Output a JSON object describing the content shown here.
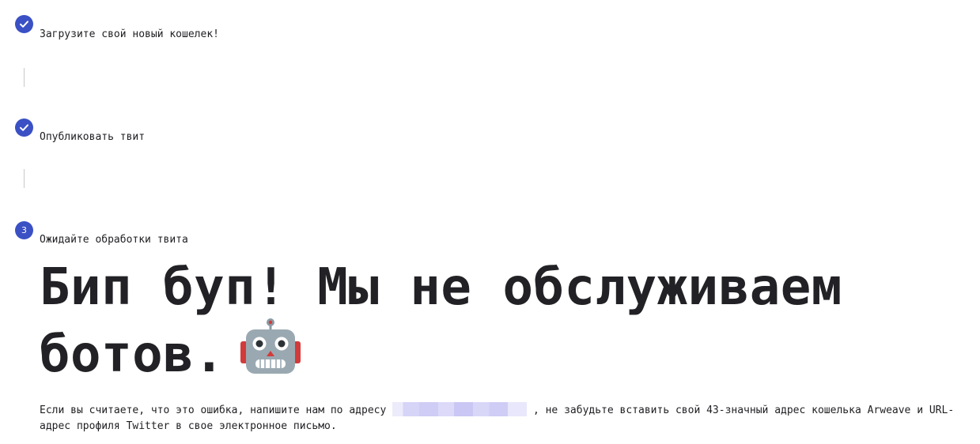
{
  "steps": [
    {
      "label": "Загрузите свой новый кошелек!",
      "status": "done",
      "icon": "check-icon"
    },
    {
      "label": "Опубликовать твит",
      "status": "done",
      "icon": "check-icon"
    },
    {
      "label": "Ожидайте обработки твита",
      "status": "current",
      "number": "3"
    }
  ],
  "heading": {
    "line1": "Бип буп! Мы не обслуживаем",
    "line2": "ботов.",
    "emoji": "robot-icon"
  },
  "message": {
    "before": "Если вы считаете, что это ошибка, напишите нам по адресу",
    "email_redacted": true,
    "after": ", не забудьте вставить свой 43-значный адрес кошелька Arweave и URL-адрес профиля Twitter в свое электронное письмо."
  },
  "colors": {
    "accent": "#3a50c4",
    "text": "#1f1f23",
    "connector": "#c9c9cc",
    "redaction": "#d0cdf6"
  }
}
